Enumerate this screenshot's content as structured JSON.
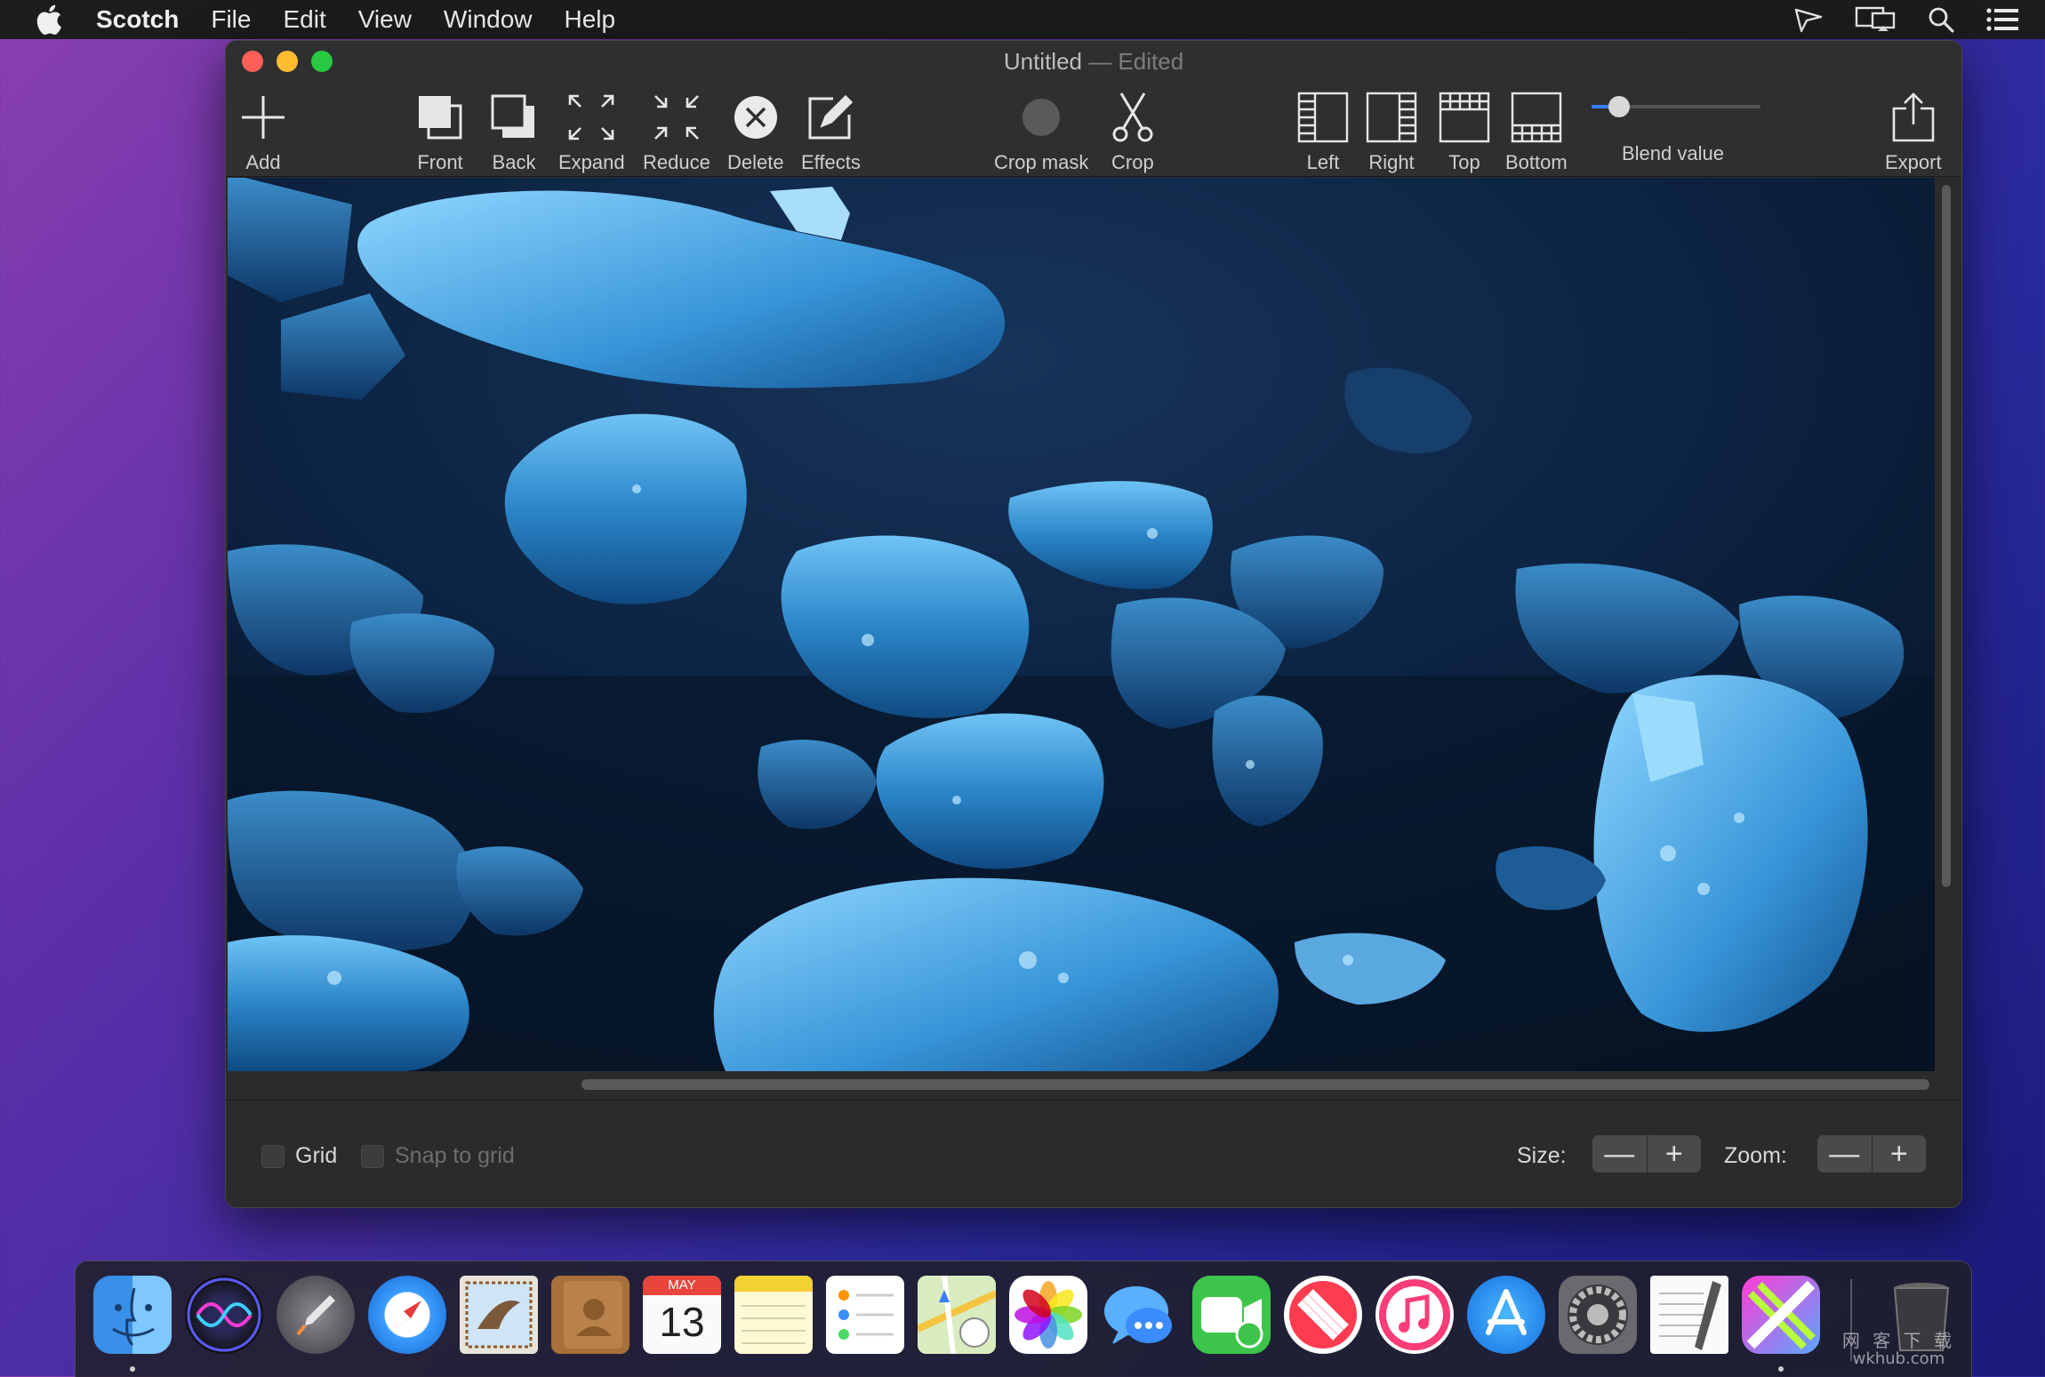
{
  "menubar": {
    "app_name": "Scotch",
    "items": [
      "File",
      "Edit",
      "View",
      "Window",
      "Help"
    ]
  },
  "window": {
    "title": "Untitled",
    "status": " — Edited"
  },
  "toolbar": {
    "add": "Add",
    "front": "Front",
    "back": "Back",
    "expand": "Expand",
    "reduce": "Reduce",
    "delete": "Delete",
    "effects": "Effects",
    "crop_mask": "Crop mask",
    "crop": "Crop",
    "left": "Left",
    "right": "Right",
    "top": "Top",
    "bottom": "Bottom",
    "blend_value": "Blend value",
    "blend_level": 0.1,
    "export": "Export"
  },
  "bottom": {
    "grid": "Grid",
    "snap": "Snap to grid",
    "size": "Size:",
    "zoom": "Zoom:",
    "minus": "—",
    "plus": "+"
  },
  "dock": {
    "apps": [
      "finder",
      "siri",
      "launchpad",
      "safari",
      "mail",
      "contacts",
      "calendar",
      "notes",
      "reminders",
      "maps",
      "photos",
      "messages",
      "facetime",
      "news",
      "music",
      "app-store",
      "system-preferences",
      "textedit",
      "scotch",
      "trash"
    ],
    "calendar_month": "MAY",
    "calendar_day": "13"
  },
  "watermark": {
    "line1": "网 客 下 载",
    "line2": "wkhub.com"
  },
  "colors": {
    "accent": "#3b7cff",
    "close": "#fe5f57",
    "minimize": "#febc2e",
    "maximize": "#28c840"
  }
}
